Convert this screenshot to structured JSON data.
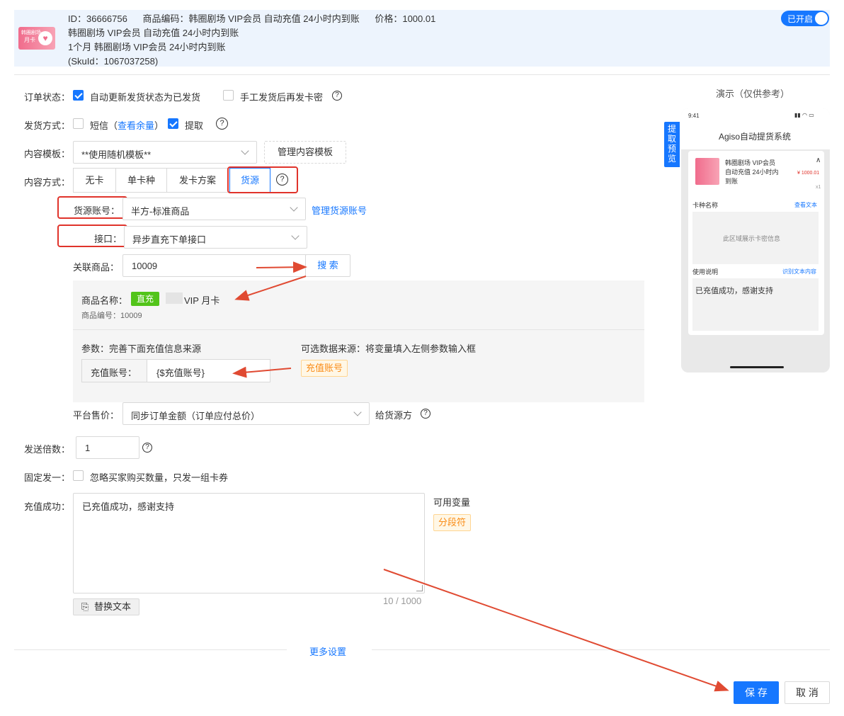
{
  "product": {
    "id_line": "ID：36666756",
    "code_line": "商品编码：韩圈剧场 VIP会员 自动充值 24小时内到账",
    "price_line": "价格：1000.01",
    "name_line": "韩圈剧场 VIP会员 自动充值 24小时内到账",
    "sku_line": "1个月 韩圈剧场 VIP会员 24小时内到账",
    "skuid_line": "(SkuId：1067037258)",
    "thumb_text1": "韩圈剧场",
    "thumb_text2": "月卡",
    "toggle_label": "已开启"
  },
  "order_status": {
    "label": "订单状态：",
    "auto_update": "自动更新发货状态为已发货",
    "manual_resend": "手工发货后再发卡密",
    "help": "?"
  },
  "delivery": {
    "label": "发货方式：",
    "sms": "短信",
    "open_paren": "（",
    "quota_link": "查看余量",
    "close_paren": "）",
    "pickup": "提取",
    "help": "?"
  },
  "template": {
    "label": "内容模板：",
    "value": "**使用随机模板**",
    "manage_button": "管理内容模板"
  },
  "content_mode": {
    "label": "内容方式：",
    "options": [
      "无卡",
      "单卡种",
      "发卡方案",
      "货源"
    ],
    "help": "?"
  },
  "source_account": {
    "label": "货源账号：",
    "value": "半方-标准商品",
    "manage_link": "管理货源账号"
  },
  "interface": {
    "label": "接口：",
    "value": "异步直充下单接口"
  },
  "linked_product": {
    "label": "关联商品：",
    "value": "10009",
    "search_button": "搜 索"
  },
  "product_info": {
    "name_label": "商品名称：",
    "tag": "直充",
    "name_value": "VIP 月卡",
    "code_line": "商品编号：10009",
    "params_label": "参数：完善下面充值信息来源",
    "optional_label": "可选数据来源：将变量填入左侧参数输入框",
    "recharge_label": "充值账号：",
    "recharge_value": "{$充值账号}",
    "recharge_tag": "充值账号"
  },
  "platform_price": {
    "label": "平台售价：",
    "value": "同步订单金额（订单应付总价）",
    "suffix": "给货源方"
  },
  "multiplier": {
    "label": "发送倍数：",
    "value": "1"
  },
  "fixed_one": {
    "label": "固定发一：",
    "option": "忽略买家购买数量，只发一组卡券"
  },
  "recharge_success": {
    "label": "充值成功：",
    "text": "已充值成功，感谢支持",
    "vars_label": "可用变量",
    "var_tag": "分段符",
    "counter": "10 / 1000",
    "replace_button": "替换文本"
  },
  "more_settings": "更多设置",
  "footer": {
    "save": "保 存",
    "cancel": "取 消"
  },
  "preview": {
    "title": "演示（仅供参考）",
    "tab": "提取预览",
    "time": "9:41",
    "app_title": "Agiso自动提货系统",
    "item_name": "韩圈剧场 VIP会员 自动充值 24小时内到账",
    "item_price": "¥ 1000.01",
    "item_qty": "x1",
    "card_name_label": "卡种名称",
    "view_text_link": "查看文本",
    "card_area_text": "此区域展示卡密信息",
    "usage_label": "使用说明",
    "identify_link": "识别文本内容",
    "usage_text": "已充值成功，感谢支持"
  },
  "colors": {
    "primary": "#1677ff",
    "highlight_red": "#e0332b",
    "tag_green": "#52c41a",
    "tag_orange": "#fa8c16"
  }
}
